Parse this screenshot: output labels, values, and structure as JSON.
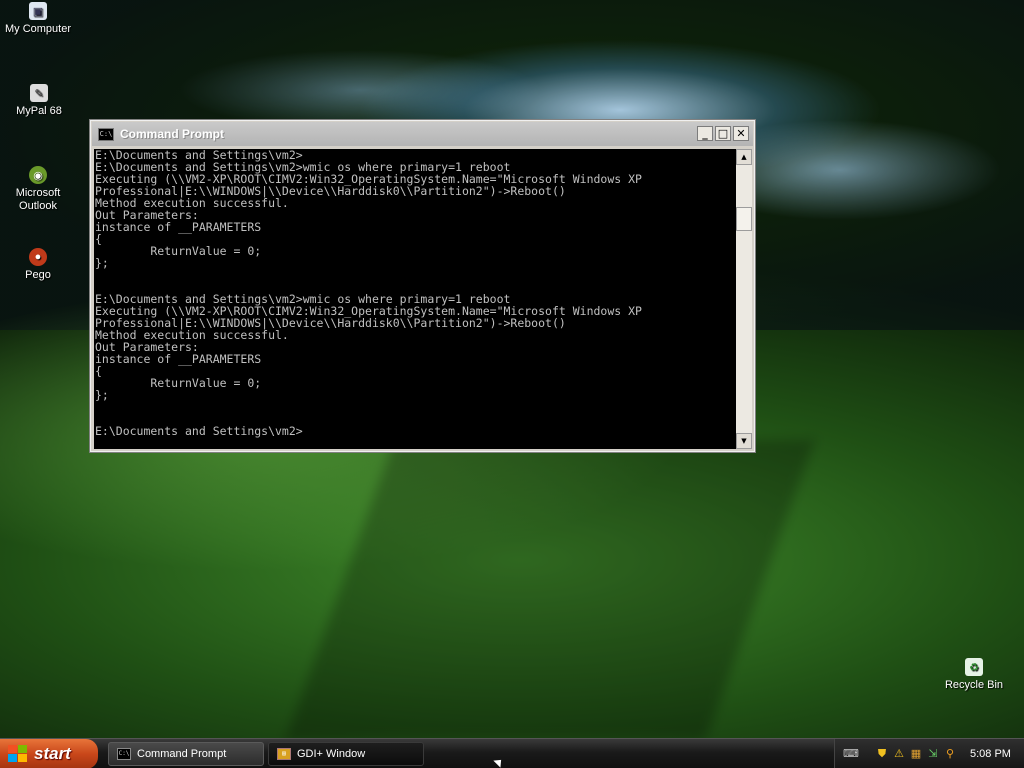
{
  "desktop": {
    "icons": [
      {
        "label": "My Computer",
        "icon": "computer-icon"
      },
      {
        "label": "MyPal 68",
        "icon": "mypal-icon"
      },
      {
        "label": "Microsoft Outlook",
        "icon": "outlook-icon"
      },
      {
        "label": "Pego",
        "icon": "pego-icon"
      },
      {
        "label": "Recycle Bin",
        "icon": "recycle-bin-icon"
      }
    ]
  },
  "window": {
    "title": "Command Prompt",
    "icon_text": "C:\\",
    "controls": {
      "minimize": "_",
      "maximize": "□",
      "close": "✕"
    },
    "console_lines": [
      "E:\\Documents and Settings\\vm2>",
      "E:\\Documents and Settings\\vm2>wmic os where primary=1 reboot",
      "Executing (\\\\VM2-XP\\ROOT\\CIMV2:Win32_OperatingSystem.Name=\"Microsoft Windows XP",
      "Professional|E:\\\\WINDOWS|\\\\Device\\\\Harddisk0\\\\Partition2\")->Reboot()",
      "Method execution successful.",
      "Out Parameters:",
      "instance of __PARAMETERS",
      "{",
      "        ReturnValue = 0;",
      "};",
      "",
      "",
      "E:\\Documents and Settings\\vm2>wmic os where primary=1 reboot",
      "Executing (\\\\VM2-XP\\ROOT\\CIMV2:Win32_OperatingSystem.Name=\"Microsoft Windows XP",
      "Professional|E:\\\\WINDOWS|\\\\Device\\\\Harddisk0\\\\Partition2\")->Reboot()",
      "Method execution successful.",
      "Out Parameters:",
      "instance of __PARAMETERS",
      "{",
      "        ReturnValue = 0;",
      "};",
      "",
      "",
      "E:\\Documents and Settings\\vm2>"
    ]
  },
  "taskbar": {
    "start_label": "start",
    "tasks": [
      {
        "label": "Command Prompt",
        "icon": "command-prompt-icon",
        "active": false
      },
      {
        "label": "GDI+ Window",
        "icon": "gdi-window-icon",
        "active": true
      }
    ],
    "tray_icons": [
      "keyboard-icon",
      "shield-icon",
      "warning-icon",
      "network-icon",
      "safely-remove-icon",
      "search-icon"
    ],
    "clock": "5:08 PM"
  }
}
